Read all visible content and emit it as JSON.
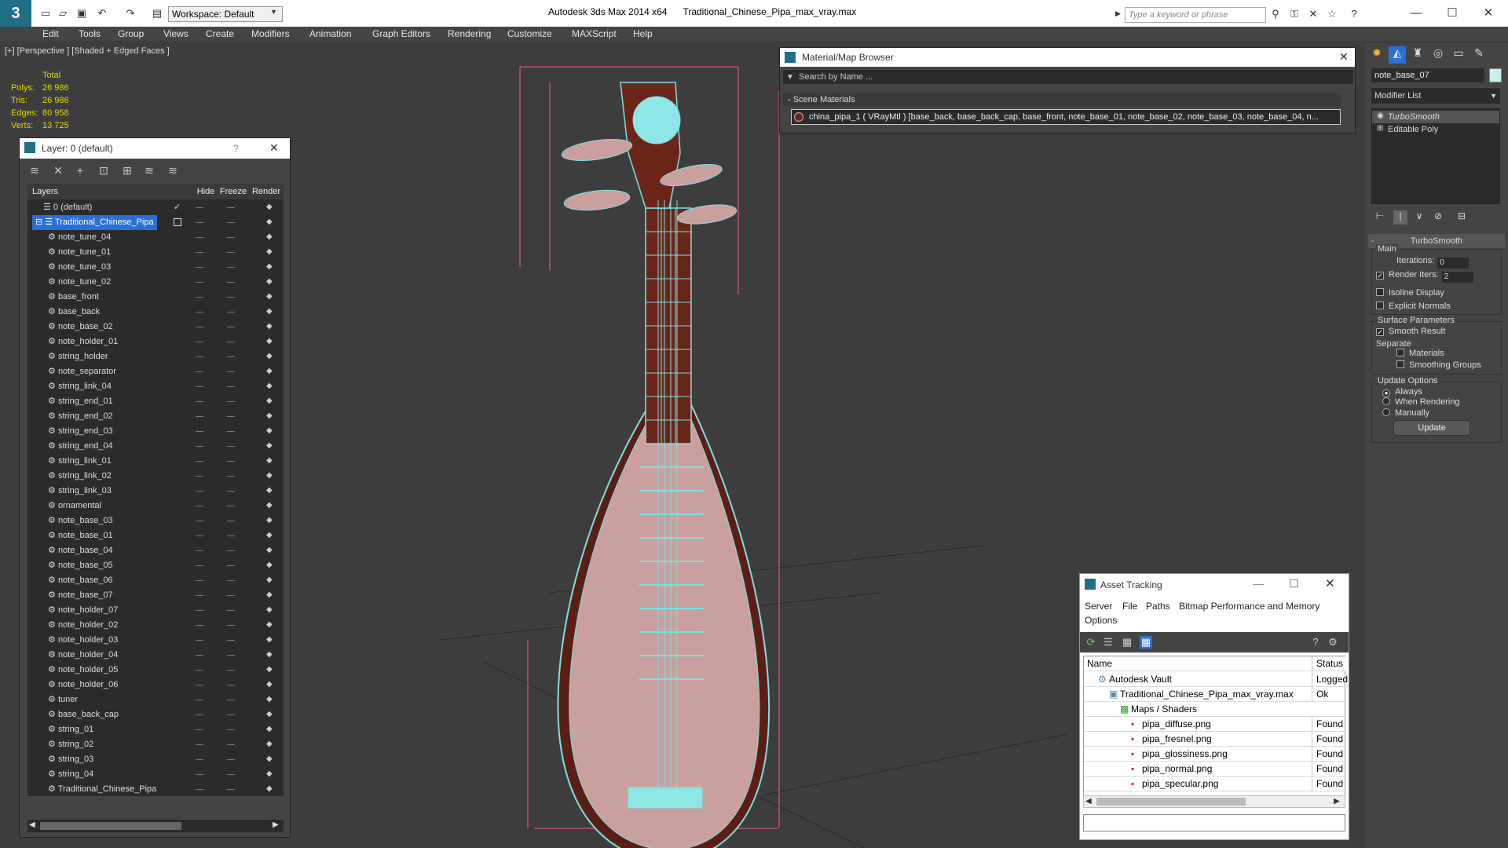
{
  "app": {
    "logo": "3",
    "title": "Autodesk 3ds Max  2014 x64",
    "file": "Traditional_Chinese_Pipa_max_vray.max",
    "workspace": "Workspace: Default",
    "search_placeholder": "Type a keyword or phrase"
  },
  "menu": [
    "Edit",
    "Tools",
    "Group",
    "Views",
    "Create",
    "Modifiers",
    "Animation",
    "Graph Editors",
    "Rendering",
    "Customize",
    "MAXScript",
    "Help"
  ],
  "viewport": {
    "label": "[+] [Perspective ] [Shaded + Edged Faces ]",
    "stats": {
      "total_label": "Total",
      "rows": [
        {
          "label": "Polys:",
          "value": "26 986"
        },
        {
          "label": "Tris:",
          "value": "26 986"
        },
        {
          "label": "Edges:",
          "value": "80 958"
        },
        {
          "label": "Verts:",
          "value": "13 725"
        }
      ]
    }
  },
  "layer_panel": {
    "title": "Layer: 0 (default)",
    "help": "?",
    "columns": {
      "layers": "Layers",
      "hide": "Hide",
      "freeze": "Freeze",
      "render": "Render"
    },
    "root": "0 (default)",
    "selected": "Traditional_Chinese_Pipa",
    "items": [
      "note_tune_04",
      "note_tune_01",
      "note_tune_03",
      "note_tune_02",
      "base_front",
      "base_back",
      "note_base_02",
      "note_holder_01",
      "string_holder",
      "note_separator",
      "string_link_04",
      "string_end_01",
      "string_end_02",
      "string_end_03",
      "string_end_04",
      "string_link_01",
      "string_link_02",
      "string_link_03",
      "ornamental",
      "note_base_03",
      "note_base_01",
      "note_base_04",
      "note_base_05",
      "note_base_06",
      "note_base_07",
      "note_holder_07",
      "note_holder_02",
      "note_holder_03",
      "note_holder_04",
      "note_holder_05",
      "note_holder_06",
      "tuner",
      "base_back_cap",
      "string_01",
      "string_02",
      "string_03",
      "string_04",
      "Traditional_Chinese_Pipa"
    ]
  },
  "material_browser": {
    "title": "Material/Map Browser",
    "search": "Search by Name ...",
    "section": "- Scene Materials",
    "material": "china_pipa_1  ( VRayMtl ) [base_back, base_back_cap, base_front, note_base_01, note_base_02, note_base_03, note_base_04, n..."
  },
  "asset_tracking": {
    "title": "Asset Tracking",
    "menu": [
      "Server",
      "File",
      "Paths",
      "Bitmap Performance and Memory",
      "Options"
    ],
    "columns": {
      "name": "Name",
      "status": "Status"
    },
    "rows": [
      {
        "name": "Autodesk Vault",
        "status": "Logged",
        "indent": 1
      },
      {
        "name": "Traditional_Chinese_Pipa_max_vray.max",
        "status": "Ok",
        "indent": 2
      },
      {
        "name": "Maps / Shaders",
        "status": "",
        "indent": 3
      },
      {
        "name": "pipa_diffuse.png",
        "status": "Found",
        "indent": 4
      },
      {
        "name": "pipa_fresnel.png",
        "status": "Found",
        "indent": 4
      },
      {
        "name": "pipa_glossiness.png",
        "status": "Found",
        "indent": 4
      },
      {
        "name": "pipa_normal.png",
        "status": "Found",
        "indent": 4
      },
      {
        "name": "pipa_specular.png",
        "status": "Found",
        "indent": 4
      }
    ]
  },
  "command_panel": {
    "object_name": "note_base_07",
    "object_color": "#c8f0f0",
    "modifier_list": "Modifier List",
    "stack": [
      "TurboSmooth",
      "Editable Poly"
    ],
    "rollout": "TurboSmooth",
    "main_label": "Main",
    "iterations_label": "Iterations:",
    "iterations": "0",
    "render_iters_label": "Render Iters:",
    "render_iters": "2",
    "isoline": "Isoline Display",
    "explicit_normals": "Explicit Normals",
    "surface_params": "Surface Parameters",
    "smooth_result": "Smooth Result",
    "separate": "Separate",
    "materials": "Materials",
    "smoothing_groups": "Smoothing Groups",
    "update_options": "Update Options",
    "always": "Always",
    "when_rendering": "When Rendering",
    "manually": "Manually",
    "update": "Update"
  },
  "colors": {
    "accent": "#2a6fd6",
    "stats": "#e8d500",
    "wire": "#7fe0e0",
    "bbox": "#ff5a8a"
  }
}
